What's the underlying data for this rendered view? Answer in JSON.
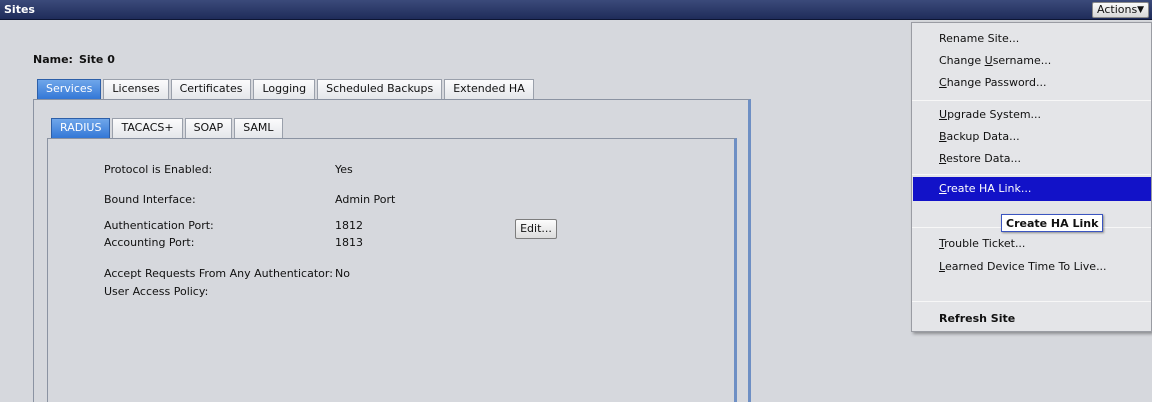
{
  "window": {
    "title": "Sites",
    "actions_label": "Actions"
  },
  "site": {
    "name_label": "Name:",
    "name_value": "Site 0"
  },
  "tabs": [
    {
      "label": "Services"
    },
    {
      "label": "Licenses"
    },
    {
      "label": "Certificates"
    },
    {
      "label": "Logging"
    },
    {
      "label": "Scheduled Backups"
    },
    {
      "label": "Extended HA"
    }
  ],
  "subtabs": [
    {
      "label": "RADIUS"
    },
    {
      "label": "TACACS+"
    },
    {
      "label": "SOAP"
    },
    {
      "label": "SAML"
    }
  ],
  "fields": {
    "protocol_enabled": {
      "label": "Protocol is Enabled:",
      "value": "Yes"
    },
    "bound_interface": {
      "label": "Bound Interface:",
      "value": "Admin Port"
    },
    "auth_port": {
      "label": "Authentication Port:",
      "value": "1812"
    },
    "acct_port": {
      "label": "Accounting Port:",
      "value": "1813"
    },
    "accept_any": {
      "label": "Accept Requests From Any Authenticator:",
      "value": "No"
    },
    "user_access_policy": {
      "label": "User Access Policy:",
      "value": ""
    }
  },
  "edit_button": {
    "label": "Edit..."
  },
  "menu": {
    "rename_site": "Rename Site...",
    "change_username": {
      "pre": "Change ",
      "u": "U",
      "post": "sername..."
    },
    "change_password": {
      "pre": "",
      "u": "C",
      "post": "hange Password..."
    },
    "upgrade_system": {
      "pre": "",
      "u": "U",
      "post": "pgrade System..."
    },
    "backup_data": {
      "pre": "",
      "u": "B",
      "post": "ackup Data..."
    },
    "restore_data": {
      "pre": "",
      "u": "R",
      "post": "estore Data..."
    },
    "create_ha_link": {
      "pre": "",
      "u": "C",
      "post": "reate HA Link..."
    },
    "trouble_ticket": {
      "pre": "",
      "u": "T",
      "post": "rouble Ticket..."
    },
    "learned_device": {
      "pre": "",
      "u": "L",
      "post": "earned Device Time To Live..."
    },
    "refresh_site": "Refresh Site"
  },
  "tooltip": "Create HA Link",
  "colors": {
    "titlebar": "#1f2c5a",
    "active_tab": "#3377d6",
    "highlight": "#1212c8"
  }
}
